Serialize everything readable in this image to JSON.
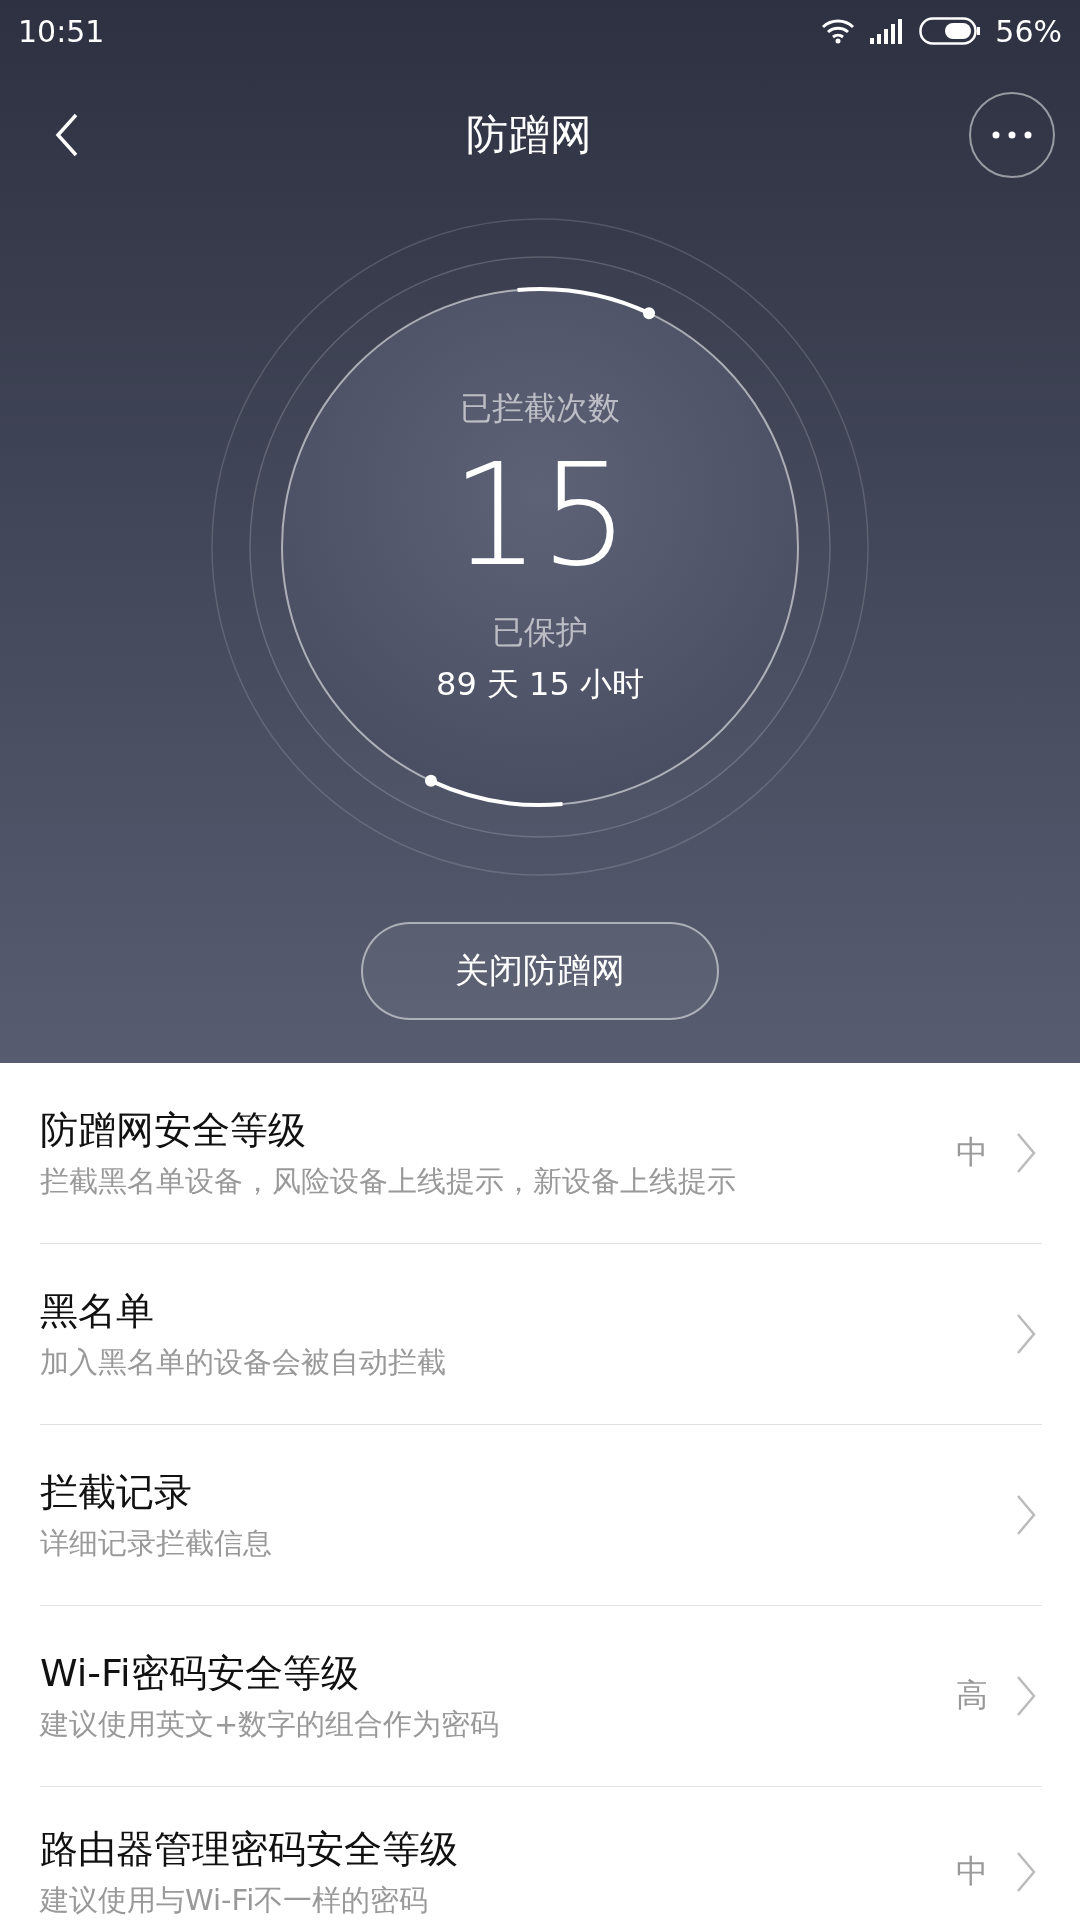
{
  "status_bar": {
    "time": "10:51",
    "battery": "56%"
  },
  "header": {
    "title": "防蹭网"
  },
  "stats": {
    "label": "已拦截次数",
    "count": "15",
    "protected_label": "已保护",
    "duration": "89 天 15 小时"
  },
  "action_button": "关闭防蹭网",
  "settings": [
    {
      "title": "防蹭网安全等级",
      "subtitle": "拦截黑名单设备，风险设备上线提示，新设备上线提示",
      "value": "中"
    },
    {
      "title": "黑名单",
      "subtitle": "加入黑名单的设备会被自动拦截"
    },
    {
      "title": "拦截记录",
      "subtitle": "详细记录拦截信息"
    },
    {
      "title": "Wi-Fi密码安全等级",
      "subtitle": "建议使用英文+数字的组合作为密码",
      "value": "高"
    },
    {
      "title": "路由器管理密码安全等级",
      "subtitle": "建议使用与Wi-Fi不一样的密码",
      "value": "中"
    }
  ]
}
